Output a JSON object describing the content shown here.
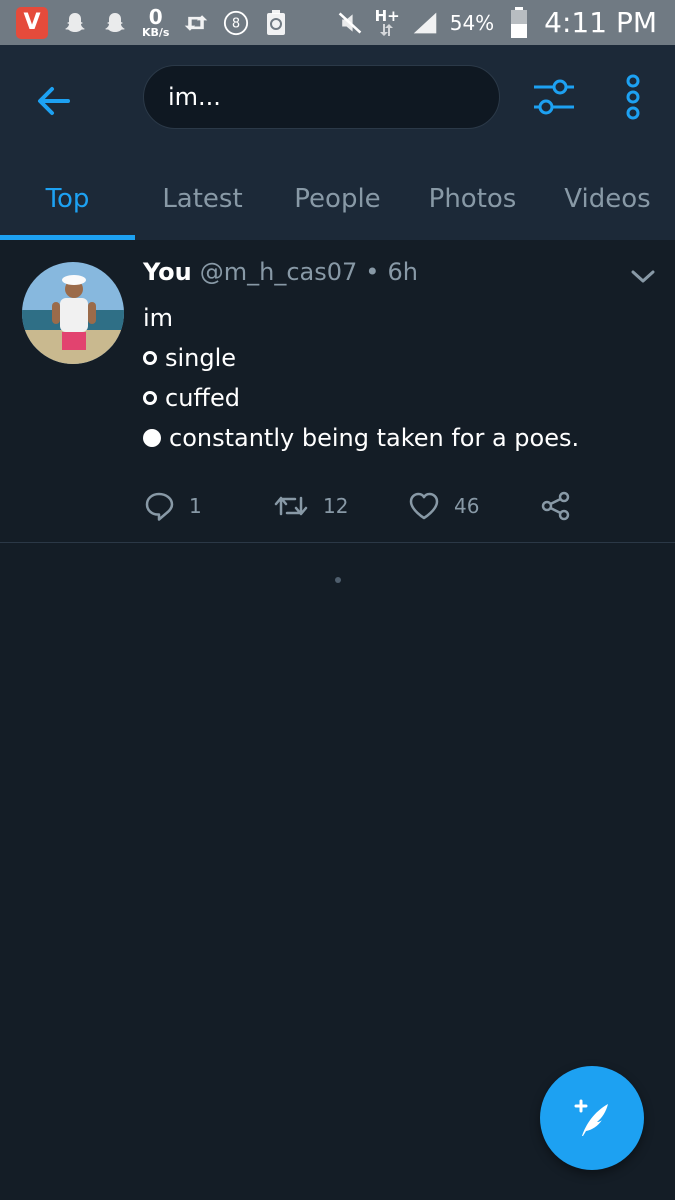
{
  "status_bar": {
    "net_speed_value": "0",
    "net_speed_unit": "KB/s",
    "network_type": "H+",
    "battery_percent": "54%",
    "time": "4:11 PM",
    "app_badge": "V",
    "notification_count": "8"
  },
  "search": {
    "query": "im..."
  },
  "tabs": [
    {
      "label": "Top",
      "active": true
    },
    {
      "label": "Latest"
    },
    {
      "label": "People"
    },
    {
      "label": "Photos"
    },
    {
      "label": "Videos"
    }
  ],
  "tweet": {
    "name": "You",
    "handle": "@m_h_cas07",
    "separator": "•",
    "time": "6h",
    "lines": [
      "im",
      "single",
      "cuffed",
      "constantly being taken for a poes."
    ],
    "reply_count": "1",
    "retweet_count": "12",
    "like_count": "46"
  },
  "icons": {
    "back": "arrow-left-icon",
    "filter": "sliders-icon",
    "more": "more-vertical-icon",
    "reply": "reply-icon",
    "retweet": "retweet-icon",
    "like": "heart-icon",
    "share": "share-icon",
    "compose": "compose-tweet-icon"
  },
  "colors": {
    "accent": "#1da1f2",
    "background": "#141d26",
    "header": "#1c2938",
    "muted": "#8899a6"
  }
}
